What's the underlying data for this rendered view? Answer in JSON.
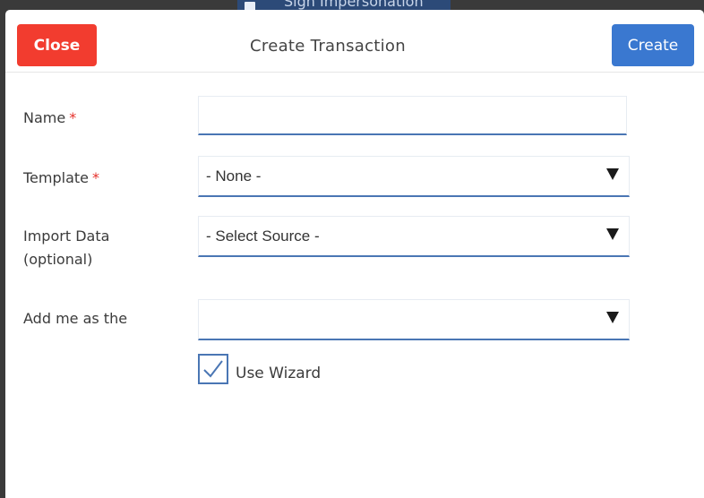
{
  "backdrop": {
    "button_text": "Sign Impersonation"
  },
  "modal": {
    "title": "Create Transaction",
    "close_label": "Close",
    "create_label": "Create"
  },
  "form": {
    "name": {
      "label": "Name",
      "required_mark": "*",
      "value": ""
    },
    "template": {
      "label": "Template",
      "required_mark": "*",
      "selected": "- None -"
    },
    "import_data": {
      "label_line1": "Import Data",
      "label_line2": "(optional)",
      "selected": "- Select Source -"
    },
    "add_me_as": {
      "label": "Add me as the",
      "selected": ""
    },
    "use_wizard": {
      "label": "Use Wizard",
      "checked": true
    }
  },
  "colors": {
    "close_button": "#f23c2f",
    "create_button": "#3a78d0",
    "input_underline": "#4a76b4",
    "required": "#e5302a"
  },
  "icons": {
    "dropdown": "chevron-down-icon",
    "checkbox": "checkmark-icon"
  }
}
